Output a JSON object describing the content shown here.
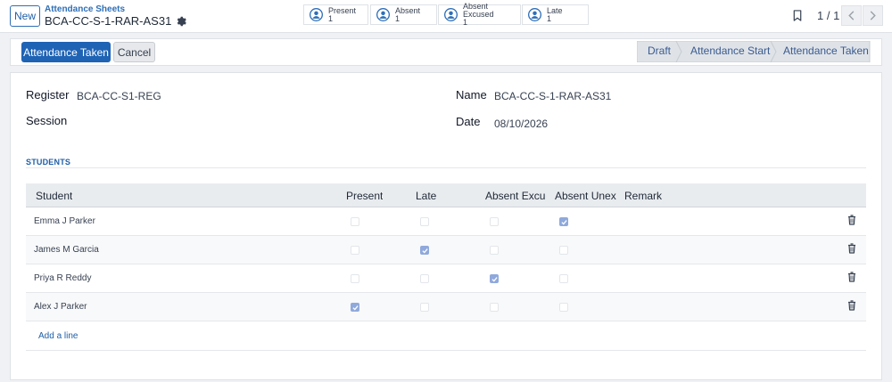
{
  "header": {
    "new_label": "New",
    "breadcrumb": "Attendance Sheets",
    "record_name": "BCA-CC-S-1-RAR-AS31"
  },
  "stats": [
    {
      "label": "Present",
      "count": "1"
    },
    {
      "label": "Absent",
      "count": "1"
    },
    {
      "label": "Absent Excused",
      "count": "1"
    },
    {
      "label": "Late",
      "count": "1"
    }
  ],
  "pager": {
    "text": "1 / 1"
  },
  "actions": {
    "primary": "Attendance Taken",
    "secondary": "Cancel"
  },
  "statusbar": {
    "stages": [
      "Draft",
      "Attendance Start",
      "Attendance Taken"
    ],
    "active": "Attendance Taken"
  },
  "form": {
    "register_label": "Register",
    "register_value": "BCA-CC-S1-REG",
    "session_label": "Session",
    "session_value": "",
    "name_label": "Name",
    "name_value": "BCA-CC-S-1-RAR-AS31",
    "date_label": "Date",
    "date_value": "08/10/2026"
  },
  "students_section": {
    "title": "STUDENTS",
    "columns": [
      "Student",
      "Present",
      "Late",
      "Absent Excu",
      "Absent Unex",
      "Remark"
    ],
    "rows": [
      {
        "student": "Emma J Parker",
        "present": false,
        "late": false,
        "absent_excused": false,
        "absent_unexcused": true,
        "remark": ""
      },
      {
        "student": "James M Garcia",
        "present": false,
        "late": true,
        "absent_excused": false,
        "absent_unexcused": false,
        "remark": ""
      },
      {
        "student": "Priya R Reddy",
        "present": false,
        "late": false,
        "absent_excused": true,
        "absent_unexcused": false,
        "remark": ""
      },
      {
        "student": "Alex J Parker",
        "present": true,
        "late": false,
        "absent_excused": false,
        "absent_unexcused": false,
        "remark": ""
      }
    ],
    "add_line": "Add a line"
  },
  "icons": {
    "user": "user-circle-icon",
    "gear": "gear-icon",
    "bookmark": "bookmark-icon",
    "prev": "chevron-left-icon",
    "next": "chevron-right-icon",
    "trash": "trash-icon"
  },
  "colors": {
    "accent": "#1f63b5",
    "stat_icon": "#2f6fb7",
    "checked": "#8fa9dc"
  }
}
